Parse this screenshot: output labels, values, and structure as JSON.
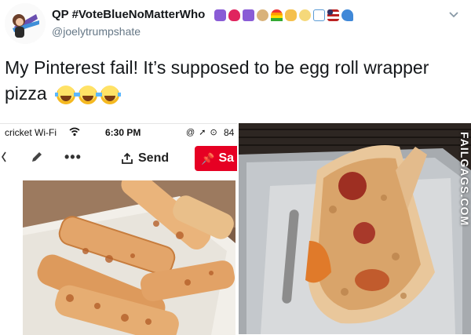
{
  "tweet": {
    "display_name": "QP #VoteBlueNoMatterWho",
    "handle": "@joelytrumpshate",
    "text": "My Pinterest fail! It’s supposed to be egg roll wrapper pizza",
    "text_emojis": [
      "laughing-tears-emoji",
      "laughing-tears-emoji",
      "laughing-tears-emoji"
    ],
    "name_emojis": [
      "peace-emoji",
      "red-heart-emoji",
      "om-emoji",
      "dog-emoji",
      "rainbow-emoji",
      "flexed-arm-emoji",
      "sun-emoji",
      "music-notes-emoji",
      "us-flag-emoji",
      "wave-emoji"
    ]
  },
  "phone": {
    "carrier": "cricket Wi-Fi",
    "time": "6:30 PM",
    "status_icons": "@ ➚ ⊙",
    "battery": "84",
    "more_label": "•••",
    "send_label": "Send",
    "save_label": "Sa"
  },
  "watermark": "FAILGAGS.COM",
  "colors": {
    "save_red": "#e60023",
    "handle_gray": "#657786",
    "text": "#14171a"
  }
}
